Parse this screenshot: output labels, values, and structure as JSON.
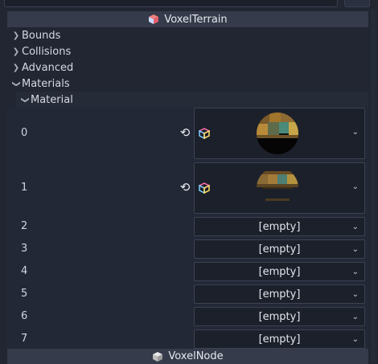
{
  "header": {
    "title": "VoxelTerrain",
    "icon": "voxel-terrain-icon"
  },
  "groups": [
    {
      "label": "Bounds",
      "expanded": false
    },
    {
      "label": "Collisions",
      "expanded": false
    },
    {
      "label": "Advanced",
      "expanded": false
    },
    {
      "label": "Materials",
      "expanded": true
    }
  ],
  "materials": {
    "sub_label": "Material",
    "items": [
      {
        "index": "0",
        "value": "",
        "has_preview": true
      },
      {
        "index": "1",
        "value": "",
        "has_preview": true
      },
      {
        "index": "2",
        "value": "[empty]"
      },
      {
        "index": "3",
        "value": "[empty]"
      },
      {
        "index": "4",
        "value": "[empty]"
      },
      {
        "index": "5",
        "value": "[empty]"
      },
      {
        "index": "6",
        "value": "[empty]"
      },
      {
        "index": "7",
        "value": "[empty]"
      }
    ]
  },
  "footer": {
    "title": "VoxelNode",
    "icon": "voxel-node-icon"
  },
  "colors": {
    "background": "#222633",
    "header": "#353b4a",
    "field": "#1c202a",
    "border": "#3b4252"
  }
}
